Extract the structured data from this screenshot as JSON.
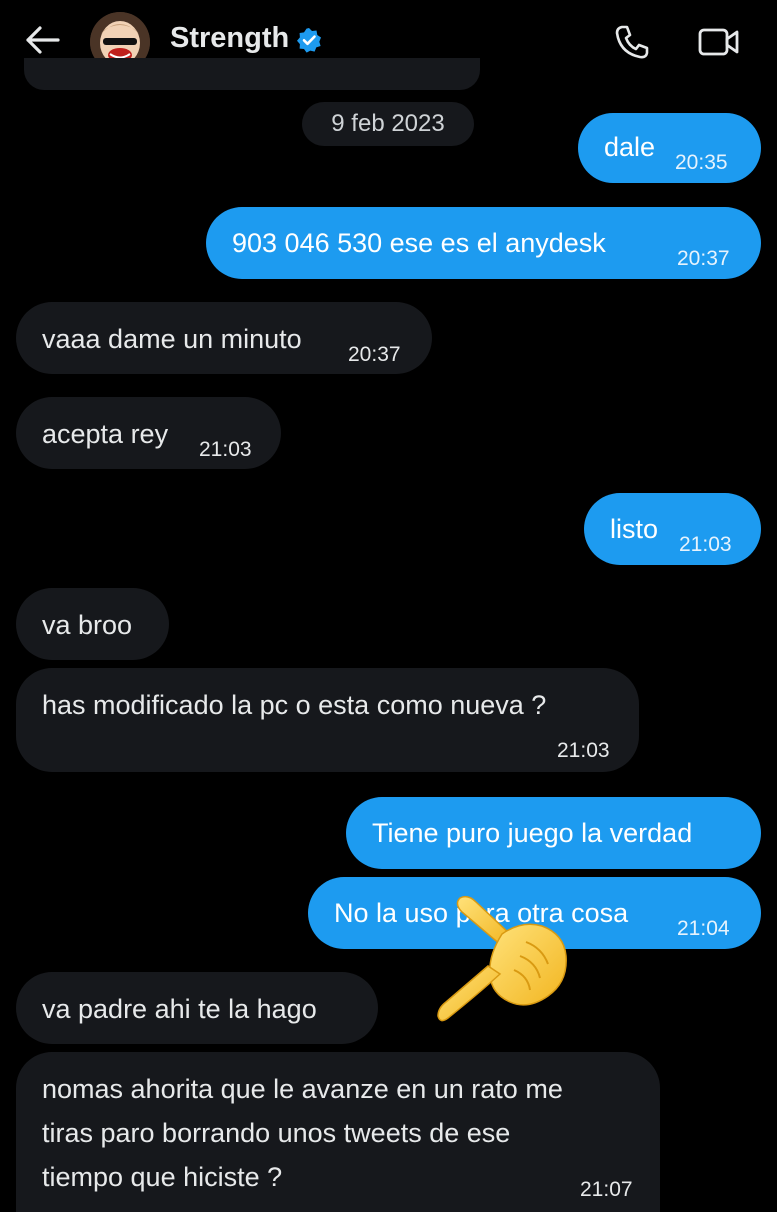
{
  "header": {
    "contact_name": "Strength",
    "icons": [
      "back-arrow-icon",
      "avatar",
      "verified-badge-icon",
      "phone-icon",
      "video-camera-icon"
    ],
    "verified_color": "#1d9bf0"
  },
  "colors": {
    "outgoing_bubble": "#1d9bf0",
    "incoming_bubble": "#16181c",
    "background": "#000000"
  },
  "date_separator": "9 feb 2023",
  "messages": [
    {
      "direction": "outgoing",
      "text": "dale",
      "time": "20:35"
    },
    {
      "direction": "outgoing",
      "text": "903 046 530 ese es el anydesk",
      "time": "20:37"
    },
    {
      "direction": "incoming",
      "text": "vaaa dame un minuto",
      "time": "20:37"
    },
    {
      "direction": "incoming",
      "text": "acepta rey",
      "time": "21:03"
    },
    {
      "direction": "outgoing",
      "text": "listo",
      "time": "21:03"
    },
    {
      "direction": "incoming",
      "text": "va broo",
      "time": ""
    },
    {
      "direction": "incoming",
      "text": "has modificado la pc o esta como nueva ?",
      "time": "21:03"
    },
    {
      "direction": "outgoing",
      "text": "Tiene puro juego la verdad",
      "time": ""
    },
    {
      "direction": "outgoing",
      "text": "No la uso para otra cosa",
      "time": "21:04"
    },
    {
      "direction": "incoming",
      "text": "va padre ahi te la hago",
      "time": ""
    },
    {
      "direction": "incoming",
      "lines": [
        "nomas ahorita que le avanze en un rato me",
        "tiras paro borrando unos tweets de ese",
        "tiempo que hiciste ?"
      ],
      "time": "21:07"
    }
  ],
  "overlay": {
    "icon": "pointing-hand-emoji-icon"
  }
}
